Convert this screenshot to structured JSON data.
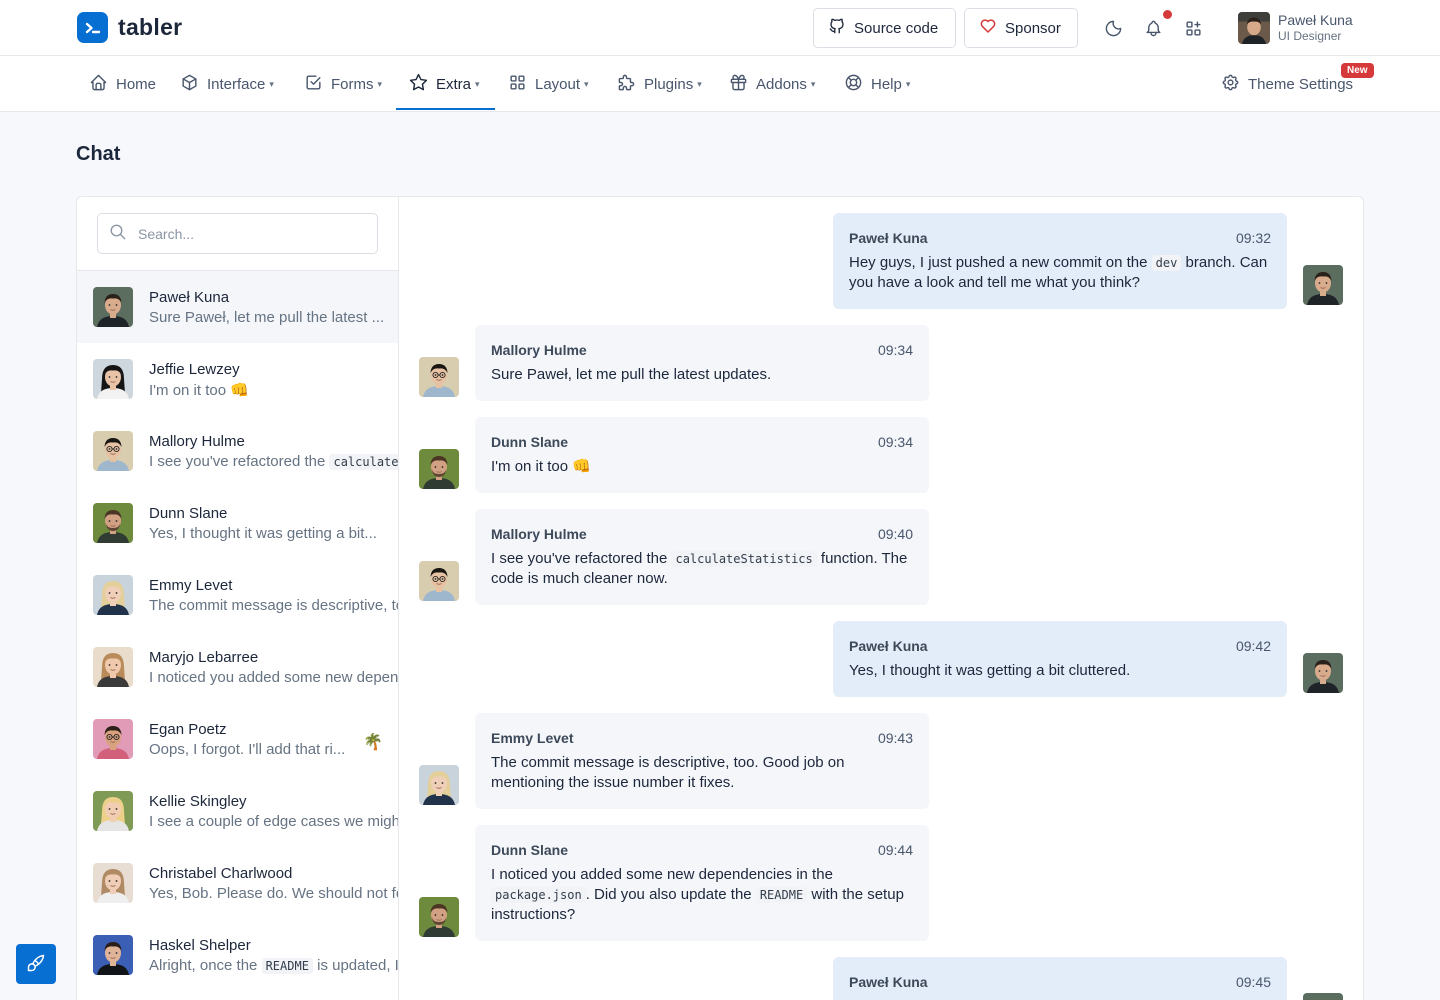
{
  "header": {
    "brand": "tabler",
    "source_code": "Source code",
    "sponsor": "Sponsor",
    "user_name": "Paweł Kuna",
    "user_role": "UI Designer"
  },
  "nav": {
    "home": "Home",
    "interface": "Interface",
    "forms": "Forms",
    "extra": "Extra",
    "layout": "Layout",
    "plugins": "Plugins",
    "addons": "Addons",
    "help": "Help",
    "theme_settings": "Theme Settings",
    "new_badge": "New",
    "active": "Extra"
  },
  "page": {
    "title": "Chat"
  },
  "search": {
    "placeholder": "Search..."
  },
  "contacts": [
    {
      "name": "Paweł Kuna",
      "pre": "Sure Paweł, let me pull the latest ...",
      "code": "",
      "post": "",
      "active": true
    },
    {
      "name": "Jeffie Lewzey",
      "pre": "I'm on it too ",
      "code": "",
      "post": "",
      "emoji": "👊"
    },
    {
      "name": "Mallory Hulme",
      "pre": "I see you've refactored the ",
      "code": "calculateStatistics",
      "post": ""
    },
    {
      "name": "Dunn Slane",
      "pre": "Yes, I thought it was getting a bit...",
      "code": "",
      "post": ""
    },
    {
      "name": "Emmy Levet",
      "pre": "The commit message is descriptive, too. Good job",
      "code": "",
      "post": ""
    },
    {
      "name": "Maryjo Lebarree",
      "pre": "I noticed you added some new dependencies",
      "code": "",
      "post": ""
    },
    {
      "name": "Egan Poetz",
      "pre": "Oops, I forgot. I'll add that ri...",
      "code": "",
      "post": "",
      "status_emoji": "🌴"
    },
    {
      "name": "Kellie Skingley",
      "pre": "I see a couple of edge cases we might",
      "code": "",
      "post": ""
    },
    {
      "name": "Christabel Charlwood",
      "pre": "Yes, Bob. Please do. We should not forget",
      "code": "",
      "post": ""
    },
    {
      "name": "Haskel Shelper",
      "pre": "Alright, once the ",
      "code": "README",
      "post": " is updated, I"
    }
  ],
  "messages": [
    {
      "author": "Paweł Kuna",
      "time": "09:32",
      "mine": true,
      "pre": "Hey guys, I just pushed a new commit on the ",
      "code": "dev",
      "post": " branch. Can you have a look and tell me what you think?"
    },
    {
      "author": "Mallory Hulme",
      "time": "09:34",
      "mine": false,
      "pre": "Sure Paweł, let me pull the latest updates.",
      "code": "",
      "post": ""
    },
    {
      "author": "Dunn Slane",
      "time": "09:34",
      "mine": false,
      "pre": "I'm on it too ",
      "code": "",
      "post": "",
      "emoji": "👊"
    },
    {
      "author": "Mallory Hulme",
      "time": "09:40",
      "mine": false,
      "pre": "I see you've refactored the ",
      "code": "calculateStatistics",
      "post": " function. The code is much cleaner now."
    },
    {
      "author": "Paweł Kuna",
      "time": "09:42",
      "mine": true,
      "pre": "Yes, I thought it was getting a bit cluttered.",
      "code": "",
      "post": ""
    },
    {
      "author": "Emmy Levet",
      "time": "09:43",
      "mine": false,
      "pre": "The commit message is descriptive, too. Good job on mentioning the issue number it fixes.",
      "code": "",
      "post": ""
    },
    {
      "author": "Dunn Slane",
      "time": "09:44",
      "mine": false,
      "pre": "I noticed you added some new dependencies in the ",
      "code": "package.json",
      "post": ". Did you also update the ",
      "code2": "README",
      "post2": " with the setup instructions?"
    },
    {
      "author": "Paweł Kuna",
      "time": "09:45",
      "mine": true,
      "pre": "",
      "code": "",
      "post": ""
    }
  ],
  "colors": {
    "accent": "#066fd1",
    "mine_bubble": "#e3edf9",
    "their_bubble": "#f4f6fa",
    "badge": "#d63939"
  }
}
